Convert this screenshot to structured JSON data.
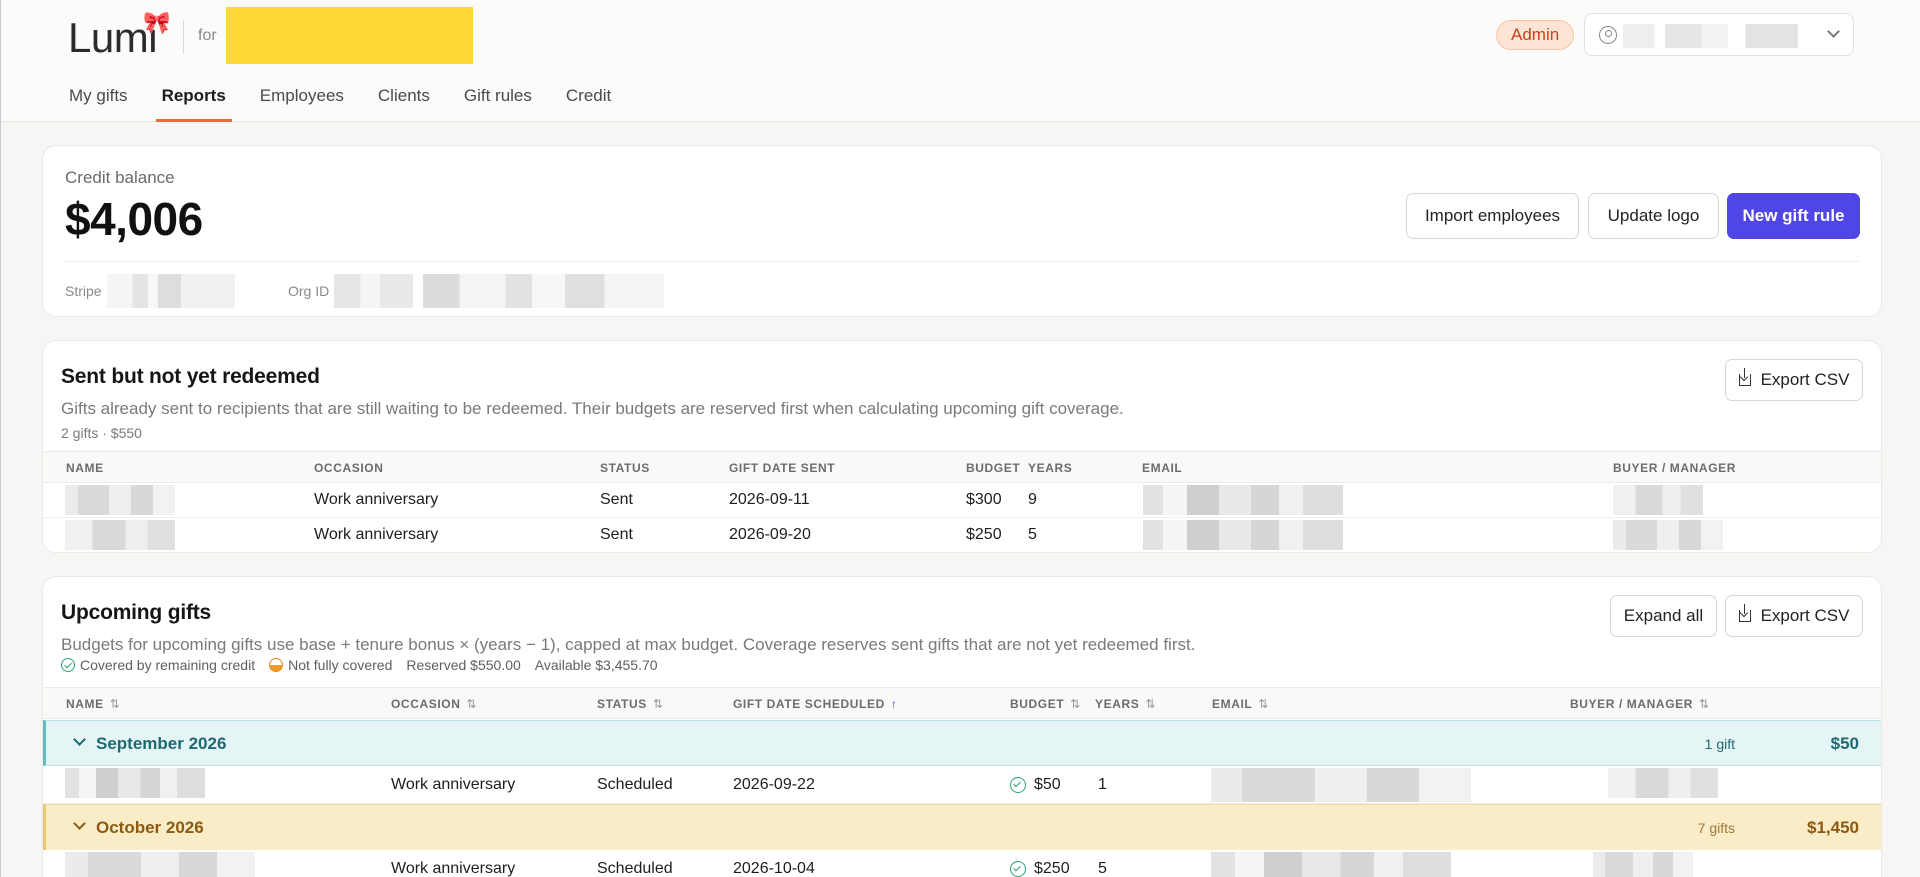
{
  "brand": {
    "logo": "Lumi",
    "for_label": "for"
  },
  "header": {
    "role_badge": "Admin"
  },
  "nav": {
    "tabs": [
      "My gifts",
      "Reports",
      "Employees",
      "Clients",
      "Gift rules",
      "Credit"
    ],
    "active": "Reports"
  },
  "balance": {
    "label": "Credit balance",
    "value": "$4,006",
    "stripe_label": "Stripe",
    "org_label": "Org ID",
    "import_button": "Import employees",
    "logo_button": "Update logo",
    "new_button": "New gift rule"
  },
  "sent": {
    "title": "Sent but not yet redeemed",
    "description": "Gifts already sent to recipients that are still waiting to be redeemed. Their budgets are reserved first when calculating upcoming gift coverage.",
    "summary": "2 gifts · $550",
    "export_button": "Export CSV",
    "columns": {
      "name": "NAME",
      "occasion": "OCCASION",
      "status": "STATUS",
      "date": "GIFT DATE SENT",
      "budget": "BUDGET",
      "years": "YEARS",
      "email": "EMAIL",
      "buyer": "BUYER / MANAGER"
    },
    "rows": [
      {
        "occasion": "Work anniversary",
        "status": "Sent",
        "date": "2026-09-11",
        "budget": "$300",
        "years": "9"
      },
      {
        "occasion": "Work anniversary",
        "status": "Sent",
        "date": "2026-09-20",
        "budget": "$250",
        "years": "5"
      }
    ]
  },
  "upcoming": {
    "title": "Upcoming gifts",
    "description": "Budgets for upcoming gifts use base + tenure bonus × (years − 1), capped at max budget. Coverage reserves sent gifts that are not yet redeemed first.",
    "legend": {
      "covered": "Covered by remaining credit",
      "not_covered": "Not fully covered",
      "reserved": "Reserved $550.00",
      "available": "Available $3,455.70"
    },
    "expand_button": "Expand all",
    "export_button": "Export CSV",
    "columns": {
      "name": "NAME",
      "occasion": "OCCASION",
      "status": "STATUS",
      "date": "GIFT DATE SCHEDULED",
      "budget": "BUDGET",
      "years": "YEARS",
      "email": "EMAIL",
      "buyer": "BUYER / MANAGER"
    },
    "sort_icon": "⇅",
    "sort_active_icon": "↑",
    "groups": [
      {
        "label": "September 2026",
        "count": "1 gift",
        "total": "$50",
        "rows": [
          {
            "occasion": "Work anniversary",
            "status": "Scheduled",
            "date": "2026-09-22",
            "budget": "$50",
            "years": "1"
          }
        ]
      },
      {
        "label": "October 2026",
        "count": "7 gifts",
        "total": "$1,450",
        "rows": [
          {
            "occasion": "Work anniversary",
            "status": "Scheduled",
            "date": "2026-10-04",
            "budget": "$250",
            "years": "5"
          }
        ]
      }
    ]
  },
  "colors": {
    "accent": "#4f46e5",
    "tab_underline": "#e96a3c",
    "org_redaction": "#fcd835",
    "covered": "#2aa56f"
  }
}
